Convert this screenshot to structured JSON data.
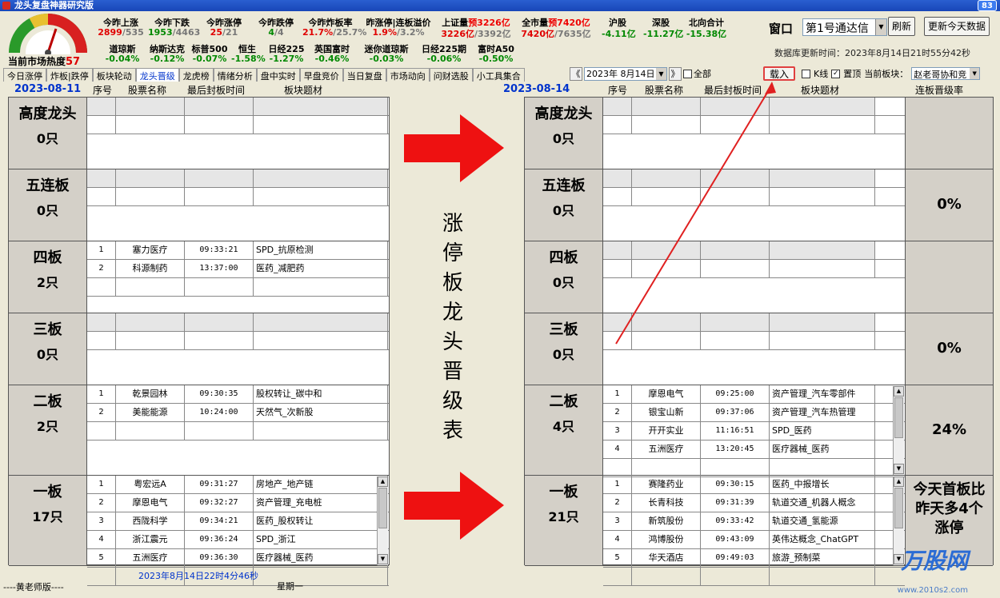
{
  "window": {
    "title": "龙头复盘神器研究版",
    "corner_value": "83"
  },
  "market": {
    "heat_label": "当前市场热度",
    "heat_value": "57"
  },
  "gauge": {
    "ticks": [
      "20",
      "30",
      "40",
      "50",
      "60",
      "70",
      "80",
      "90",
      "10"
    ]
  },
  "stats_row1": [
    {
      "label": "今昨上涨",
      "val_a": "2899",
      "val_b": "/535",
      "color_a": "#e00000"
    },
    {
      "label": "今昨下跌",
      "val_a": "1953",
      "val_b": "/4463",
      "color_a": "#008800"
    },
    {
      "label": "今昨涨停",
      "val_a": "25",
      "val_b": "/21",
      "color_a": "#e00000"
    },
    {
      "label": "今昨跌停",
      "val_a": "4",
      "val_b": "/4",
      "color_a": "#008800"
    },
    {
      "label": "今昨炸板率",
      "val_a": "21.7%",
      "val_b": "/25.7%",
      "color_a": "#e00000"
    },
    {
      "label": "昨涨停|连板溢价",
      "val_a": "1.9%",
      "val_b": "/3.2%",
      "color_a": "#e00000"
    },
    {
      "label": "上证量",
      "label_extra": "预3226亿",
      "val_a": "3226亿",
      "val_b": "/3392亿",
      "color_a": "#e00000"
    },
    {
      "label": "全市量",
      "label_extra": "预7420亿",
      "val_a": "7420亿",
      "val_b": "/7635亿",
      "color_a": "#e00000"
    },
    {
      "label": "沪股",
      "val_a": "-4.11亿",
      "val_b": "",
      "color_a": "#008800"
    },
    {
      "label": "深股",
      "val_a": "-11.27亿",
      "val_b": "",
      "color_a": "#008800"
    },
    {
      "label": "北向合计",
      "val_a": "-15.38亿",
      "val_b": "",
      "color_a": "#008800"
    }
  ],
  "stats_row2": [
    {
      "label": "道琼斯",
      "val": "-0.04%"
    },
    {
      "label": "纳斯达克",
      "val": "-0.12%"
    },
    {
      "label": "标普500",
      "val": "-0.07%"
    },
    {
      "label": "恒生",
      "val": "-1.58%"
    },
    {
      "label": "日经225",
      "val": "-1.27%"
    },
    {
      "label": "英国富时",
      "val": "-0.46%"
    },
    {
      "label": "迷你道琼斯",
      "val": "-0.03%"
    },
    {
      "label": "日经225期",
      "val": "-0.06%"
    },
    {
      "label": "富时A50",
      "val": "-0.50%"
    }
  ],
  "controls": {
    "window_label": "窗口",
    "window_select": "第1号通达信",
    "refresh": "刷新",
    "update_today": "更新今天数据",
    "db_update_time": "数据库更新时间：2023年8月14日21时55分42秒",
    "load": "载入",
    "kline": "K线",
    "pin_top": "置顶",
    "current_sector_label": "当前板块：",
    "current_sector": "赵老哥协和竞",
    "date_value": "2023年 8月14日",
    "all_label": "全部"
  },
  "tabs": [
    "今日涨停",
    "炸板|跌停",
    "板块轮动",
    "龙头晋级",
    "龙虎榜",
    "情绪分析",
    "盘中实时",
    "早盘竞价",
    "当日复盘",
    "市场动向",
    "问财选股",
    "小工具集合"
  ],
  "active_tab": 3,
  "left": {
    "date": "2023-08-11",
    "headers": {
      "seq": "序号",
      "name": "股票名称",
      "time": "最后封板时间",
      "topic": "板块题材"
    },
    "levels": [
      {
        "name": "高度龙头",
        "count": "0只",
        "rows": []
      },
      {
        "name": "五连板",
        "count": "0只",
        "rows": []
      },
      {
        "name": "四板",
        "count": "2只",
        "rows": [
          {
            "n": "1",
            "name": "塞力医疗",
            "time": "09:33:21",
            "topic": "SPD_抗原检测"
          },
          {
            "n": "2",
            "name": "科源制药",
            "time": "13:37:00",
            "topic": "医药_减肥药"
          }
        ]
      },
      {
        "name": "三板",
        "count": "0只",
        "rows": []
      },
      {
        "name": "二板",
        "count": "2只",
        "rows": [
          {
            "n": "1",
            "name": "乾景园林",
            "time": "09:30:35",
            "topic": "股权转让_碳中和"
          },
          {
            "n": "2",
            "name": "美能能源",
            "time": "10:24:00",
            "topic": "天然气_次新股"
          }
        ]
      },
      {
        "name": "一板",
        "count": "17只",
        "rows": [
          {
            "n": "1",
            "name": "粤宏远A",
            "time": "09:31:27",
            "topic": "房地产_地产链"
          },
          {
            "n": "2",
            "name": "摩恩电气",
            "time": "09:32:27",
            "topic": "资产管理_充电桩"
          },
          {
            "n": "3",
            "name": "西陇科学",
            "time": "09:34:21",
            "topic": "医药_股权转让"
          },
          {
            "n": "4",
            "name": "浙江震元",
            "time": "09:36:24",
            "topic": "SPD_浙江"
          },
          {
            "n": "5",
            "name": "五洲医疗",
            "time": "09:36:30",
            "topic": "医疗器械_医药"
          }
        ]
      }
    ]
  },
  "right": {
    "date": "2023-08-14",
    "headers": {
      "seq": "序号",
      "name": "股票名称",
      "time": "最后封板时间",
      "topic": "板块题材",
      "rate": "连板晋级率"
    },
    "levels": [
      {
        "name": "高度龙头",
        "count": "0只",
        "rate": "",
        "rows": []
      },
      {
        "name": "五连板",
        "count": "0只",
        "rate": "0%",
        "rows": []
      },
      {
        "name": "四板",
        "count": "0只",
        "rate": "",
        "rows": []
      },
      {
        "name": "三板",
        "count": "0只",
        "rate": "0%",
        "rows": []
      },
      {
        "name": "二板",
        "count": "4只",
        "rate": "24%",
        "rows": [
          {
            "n": "1",
            "name": "摩恩电气",
            "time": "09:25:00",
            "topic": "资产管理_汽车零部件"
          },
          {
            "n": "2",
            "name": "银宝山新",
            "time": "09:37:06",
            "topic": "资产管理_汽车热管理"
          },
          {
            "n": "3",
            "name": "开开实业",
            "time": "11:16:51",
            "topic": "SPD_医药"
          },
          {
            "n": "4",
            "name": "五洲医疗",
            "time": "13:20:45",
            "topic": "医疗器械_医药"
          }
        ]
      },
      {
        "name": "一板",
        "count": "21只",
        "rate": "今天首板比昨天多4个涨停",
        "rows": [
          {
            "n": "1",
            "name": "赛隆药业",
            "time": "09:30:15",
            "topic": "医药_中报增长"
          },
          {
            "n": "2",
            "name": "长青科技",
            "time": "09:31:39",
            "topic": "轨道交通_机器人概念"
          },
          {
            "n": "3",
            "name": "新筑股份",
            "time": "09:33:42",
            "topic": "轨道交通_氢能源"
          },
          {
            "n": "4",
            "name": "鸿博股份",
            "time": "09:43:09",
            "topic": "英伟达概念_ChatGPT"
          },
          {
            "n": "5",
            "name": "华天酒店",
            "time": "09:49:03",
            "topic": "旅游_预制菜"
          }
        ]
      }
    ]
  },
  "center_text": "涨停板龙头晋级表",
  "footer": {
    "author": "----黄老师版----",
    "datetime": "2023年8月14日22时4分46秒",
    "weekday": "星期一"
  },
  "watermark": {
    "site": "www.2010s2.com",
    "logo": "万股网"
  }
}
